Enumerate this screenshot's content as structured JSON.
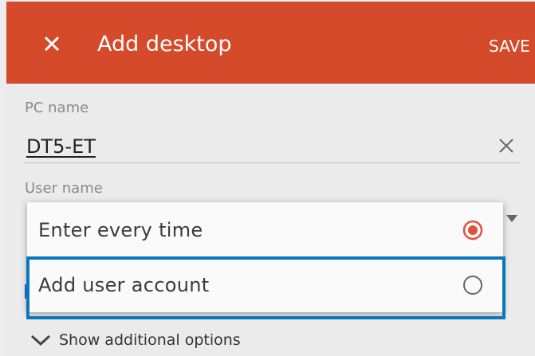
{
  "appbar": {
    "title": "Add desktop",
    "save_label": "SAVE",
    "close_icon": "close-icon",
    "color": "#d44a2a"
  },
  "form": {
    "pc_name_label": "PC name",
    "pc_name_value": "DT5-ET",
    "user_name_label": "User name",
    "show_more_label": "Show additional options"
  },
  "dropdown": {
    "options": [
      {
        "label": "Enter every time",
        "selected": true
      },
      {
        "label": "Add user account",
        "selected": false
      }
    ],
    "accent": "#e0503a"
  },
  "highlight_color": "#0a77b8"
}
